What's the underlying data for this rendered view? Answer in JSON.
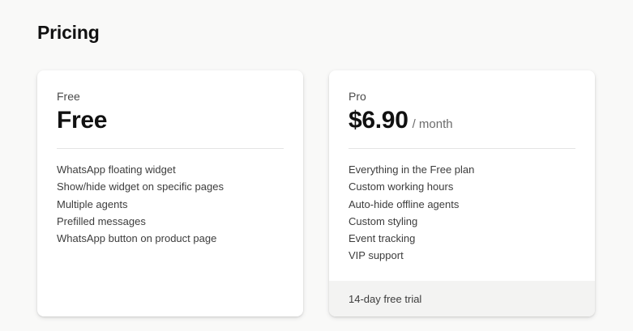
{
  "page": {
    "title": "Pricing"
  },
  "plans": [
    {
      "name": "Free",
      "price": "Free",
      "period": "",
      "features": [
        "WhatsApp floating widget",
        "Show/hide widget on specific pages",
        "Multiple agents",
        "Prefilled messages",
        "WhatsApp button on product page"
      ]
    },
    {
      "name": "Pro",
      "price": "$6.90",
      "period": "/ month",
      "features": [
        "Everything in the Free plan",
        "Custom working hours",
        "Auto-hide offline agents",
        "Custom styling",
        "Event tracking",
        "VIP support"
      ],
      "footer": "14-day free trial"
    }
  ],
  "colors": {
    "background": "#f9f9f8",
    "card": "#ffffff",
    "footer": "#f3f3f2"
  }
}
